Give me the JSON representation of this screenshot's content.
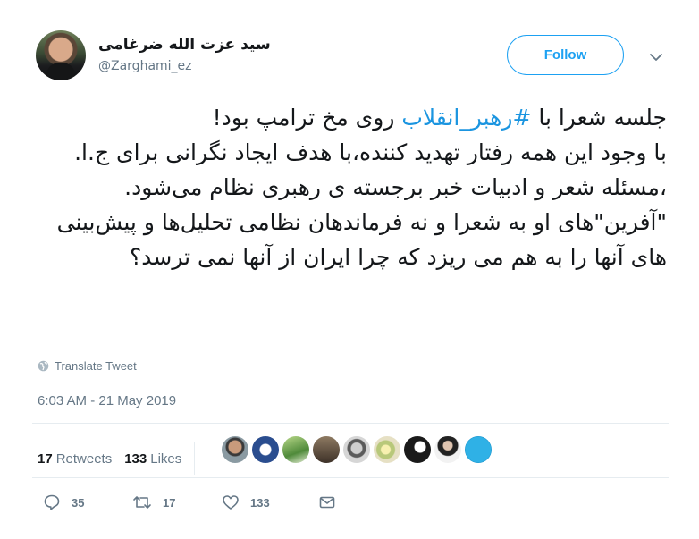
{
  "author": {
    "name": "سید عزت الله ضرغامی",
    "handle": "@Zarghami_ez"
  },
  "follow_label": "Follow",
  "tweet": {
    "line1_pre": "جلسه شعرا با ",
    "hashtag": "#رهبر_انقلاب",
    "line1_post": " روی مخ ترامپ بود!",
    "body": "با وجود این همه رفتار تهدید کننده،با هدف ایجاد نگرانی برای ج.ا. ،مسئله شعر و ادبیات خبر برجسته ی رهبری نظام می‌شود.\n\"آفرین\"های او به شعرا و نه فرماندهان نظامی تحلیل‌ها و پیش‌بینی های آنها را به هم می ریزد که چرا ایران از آنها نمی ترسد؟"
  },
  "translate_label": "Translate Tweet",
  "timestamp": "6:03 AM - 21 May 2019",
  "stats": {
    "retweets_count": "17",
    "retweets_label": "Retweets",
    "likes_count": "133",
    "likes_label": "Likes"
  },
  "actions": {
    "replies": "35",
    "retweets": "17",
    "likes": "133"
  },
  "colors": {
    "accent": "#1da1f2",
    "hashtag": "#1b95e0",
    "muted": "#657786",
    "text": "#14171a",
    "divider": "#e6ecf0"
  }
}
